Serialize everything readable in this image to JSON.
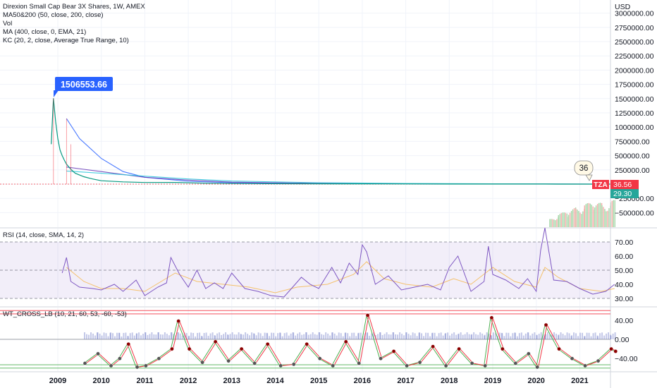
{
  "legend": {
    "title": "Direxion Small Cap Bear 3X Shares, 1W, AMEX",
    "ma_line": "MA50&200 (50, close, 200, close)",
    "vol_line": "Vol",
    "ema_line": "MA (400, close, 0, EMA, 21)",
    "kc_line": "KC (20, 2, close, Average True Range, 10)"
  },
  "rsi_legend": "RSI (14, close, SMA, 14, 2)",
  "wt_legend": "WT_CROSS_LB (10, 21, 60, 53, -60, -53)",
  "currency": "USD",
  "callouts": {
    "high": "1506553.66",
    "recent": "36"
  },
  "badges": {
    "ticker": "TZA",
    "last_price": "36.56",
    "ma_value": "29.30"
  },
  "colors": {
    "price": "#089981",
    "down": "#f23645",
    "ma_blue": "#2962ff",
    "ma_purple": "#673ab7",
    "ma_cyan": "#26c6da",
    "rsi_line": "#7e57c2",
    "rsi_ma": "#f5c16c",
    "wt_green": "#4caf50",
    "wt_red": "#f23645",
    "callout_blue": "#2962ff",
    "badge_red": "#f23645",
    "badge_teal": "#26a69a"
  },
  "chart_data": {
    "type": "line",
    "x_ticks": [
      "2009",
      "2010",
      "2011",
      "2012",
      "2013",
      "2014",
      "2015",
      "2016",
      "2017",
      "2018",
      "2019",
      "2020",
      "2021"
    ],
    "price_axis": {
      "ticks": [
        "3000000.00",
        "2750000.00",
        "2500000.00",
        "2250000.00",
        "2000000.00",
        "1750000.00",
        "1500000.00",
        "1250000.00",
        "1000000.00",
        "750000.00",
        "500000.00",
        "250000.00",
        "0.00",
        "−250000.00",
        "−500000.00"
      ],
      "ylim": [
        -600000,
        3000000
      ]
    },
    "price": {
      "x": [
        2008.85,
        2008.9,
        2008.95,
        2009.0,
        2009.05,
        2009.1,
        2009.15,
        2009.2,
        2009.3,
        2009.4,
        2009.6,
        2009.8,
        2010.0,
        2010.5,
        2011.0,
        2011.7,
        2012.5,
        2013.5,
        2014.5,
        2015.5,
        2016.5,
        2017.5,
        2018.5,
        2019.5,
        2020.2,
        2020.5,
        2021.0,
        2021.5,
        2021.8
      ],
      "y": [
        700000,
        1506553.66,
        1100000,
        800000,
        600000,
        500000,
        420000,
        350000,
        260000,
        190000,
        130000,
        90000,
        60000,
        40000,
        28000,
        30000,
        15000,
        9000,
        6000,
        4500,
        3500,
        2500,
        1800,
        1200,
        900,
        400,
        120,
        40,
        36.56
      ]
    },
    "moving_averages": [
      {
        "x": [
          2009.2,
          2009.5,
          2010.0,
          2010.5,
          2011.0,
          2012.0,
          2013.0,
          2015.0,
          2017.0,
          2019.0,
          2021.8
        ],
        "y": [
          1150000,
          800000,
          450000,
          220000,
          120000,
          50000,
          25000,
          10000,
          6000,
          3000,
          29.3
        ]
      },
      {
        "x": [
          2009.2,
          2009.6,
          2010.0,
          2010.5,
          2011.0,
          2012.0,
          2013.0,
          2015.0,
          2017.0,
          2019.0,
          2021.8
        ],
        "y": [
          300000,
          260000,
          220000,
          170000,
          120000,
          70000,
          35000,
          15000,
          8000,
          4000,
          50
        ]
      },
      {
        "x": [
          2009.2,
          2010.0,
          2011.0,
          2012.0,
          2013.0,
          2015.0,
          2017.0,
          2019.0,
          2021.8
        ],
        "y": [
          230000,
          190000,
          140000,
          90000,
          55000,
          25000,
          12000,
          6000,
          100
        ]
      }
    ],
    "volume": {
      "x": [
        2020.3,
        2020.5,
        2020.7,
        2020.9,
        2021.1,
        2021.3,
        2021.5,
        2021.7,
        2021.8
      ],
      "values": [
        0.3,
        0.45,
        0.6,
        0.7,
        0.8,
        0.95,
        0.85,
        0.9,
        1.0
      ]
    },
    "rsi": {
      "ticks": [
        "70.00",
        "60.00",
        "50.00",
        "40.00",
        "30.00"
      ],
      "ylim": [
        25,
        75
      ],
      "bands": [
        30,
        50,
        70
      ],
      "x": [
        2009.1,
        2009.2,
        2009.3,
        2009.5,
        2009.8,
        2010.0,
        2010.3,
        2010.5,
        2010.8,
        2011.0,
        2011.3,
        2011.5,
        2011.6,
        2011.8,
        2012.0,
        2012.2,
        2012.4,
        2012.6,
        2012.8,
        2013.0,
        2013.3,
        2013.6,
        2013.9,
        2014.2,
        2014.4,
        2014.6,
        2014.8,
        2015.0,
        2015.3,
        2015.5,
        2015.7,
        2015.9,
        2016.0,
        2016.1,
        2016.3,
        2016.6,
        2016.9,
        2017.2,
        2017.5,
        2017.8,
        2018.0,
        2018.2,
        2018.5,
        2018.8,
        2018.9,
        2019.0,
        2019.3,
        2019.6,
        2019.8,
        2020.0,
        2020.1,
        2020.2,
        2020.4,
        2020.7,
        2021.0,
        2021.3,
        2021.6,
        2021.8
      ],
      "y": [
        48,
        59,
        42,
        38,
        37,
        36,
        40,
        35,
        43,
        32,
        38,
        41,
        59,
        47,
        38,
        50,
        37,
        41,
        37,
        48,
        37,
        35,
        32,
        31,
        38,
        45,
        40,
        37,
        52,
        41,
        55,
        47,
        68,
        63,
        40,
        46,
        36,
        38,
        40,
        36,
        52,
        60,
        35,
        42,
        67,
        47,
        43,
        37,
        44,
        35,
        64,
        80,
        43,
        42,
        37,
        33,
        35,
        40
      ]
    },
    "rsi_ma": {
      "x": [
        2009.2,
        2009.6,
        2010.0,
        2010.5,
        2011.0,
        2011.7,
        2012.2,
        2012.8,
        2013.4,
        2014.0,
        2014.5,
        2015.2,
        2015.8,
        2016.1,
        2016.5,
        2017.0,
        2017.6,
        2018.1,
        2018.5,
        2019.0,
        2019.5,
        2020.0,
        2020.2,
        2020.5,
        2021.0,
        2021.5,
        2021.8
      ],
      "y": [
        52,
        42,
        37,
        37,
        35,
        48,
        42,
        40,
        38,
        34,
        38,
        40,
        47,
        56,
        44,
        40,
        38,
        44,
        40,
        52,
        42,
        38,
        52,
        45,
        37,
        35,
        37
      ]
    },
    "wt": {
      "ticks": [
        "40.00",
        "0.00",
        "−40.00"
      ],
      "ylim": [
        -70,
        55
      ],
      "levels": [
        -60,
        -53,
        53,
        60
      ],
      "x": [
        2009.6,
        2009.9,
        2010.2,
        2010.4,
        2010.6,
        2010.8,
        2011.0,
        2011.3,
        2011.6,
        2011.75,
        2012.0,
        2012.3,
        2012.6,
        2012.9,
        2013.2,
        2013.5,
        2013.8,
        2014.1,
        2014.4,
        2014.7,
        2015.0,
        2015.3,
        2015.6,
        2015.9,
        2016.1,
        2016.4,
        2016.7,
        2017.0,
        2017.3,
        2017.6,
        2017.9,
        2018.2,
        2018.5,
        2018.8,
        2018.95,
        2019.2,
        2019.5,
        2019.8,
        2020.0,
        2020.2,
        2020.5,
        2020.8,
        2021.1,
        2021.4,
        2021.7,
        2021.8
      ],
      "y": [
        -50,
        -30,
        -55,
        -40,
        -10,
        -58,
        -55,
        -40,
        -20,
        38,
        -20,
        -48,
        -5,
        -45,
        -20,
        -50,
        -10,
        -55,
        -52,
        -10,
        -40,
        -55,
        -5,
        -50,
        50,
        -40,
        -25,
        -55,
        -48,
        -15,
        -55,
        -20,
        -50,
        -55,
        45,
        -20,
        -50,
        -30,
        -58,
        30,
        -20,
        -40,
        -55,
        -45,
        -20,
        -25
      ]
    }
  }
}
